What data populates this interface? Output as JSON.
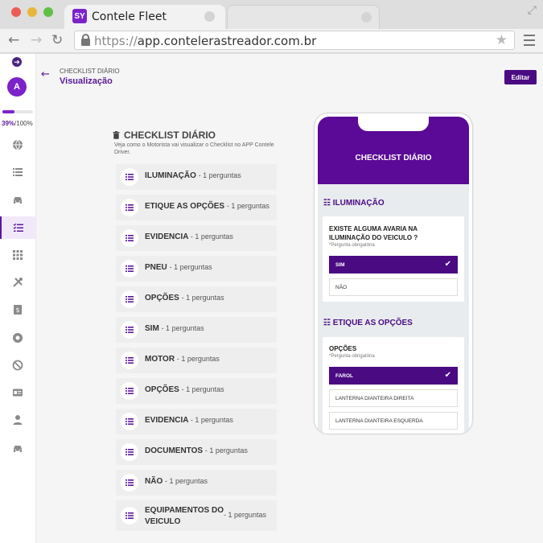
{
  "browser": {
    "tab_title": "Contele Fleet",
    "tab_logo": "SY",
    "url_protocol": "https://",
    "url_host": "app.contelerastreador.com.br"
  },
  "sidebar": {
    "avatar_initial": "A",
    "progress_percent": 39,
    "progress_value": "39%",
    "progress_total": "/100%",
    "icons": [
      "globe-icon",
      "list-icon",
      "car-icon",
      "checklist-icon",
      "grid-icon",
      "tools-icon",
      "document-dollar-icon",
      "record-icon",
      "block-icon",
      "id-card-icon",
      "user-icon",
      "car-icon"
    ]
  },
  "header": {
    "breadcrumb": "CHECKLIST DIÁRIO",
    "title": "Visualização",
    "edit_label": "Editar"
  },
  "checklist": {
    "title": "CHECKLIST DIÁRIO",
    "description": "Veja como o Motorista vai visualizar o Checklist no APP Contele Driver.",
    "categories": [
      {
        "name": "ILUMINAÇÃO",
        "count": "- 1 perguntas"
      },
      {
        "name": "ETIQUE AS OPÇÕES",
        "count": "- 1 perguntas"
      },
      {
        "name": "EVIDENCIA",
        "count": "- 1 perguntas"
      },
      {
        "name": "PNEU",
        "count": "- 1 perguntas"
      },
      {
        "name": "OPÇÕES",
        "count": "- 1 perguntas"
      },
      {
        "name": "SIM",
        "count": "- 1 perguntas"
      },
      {
        "name": "MOTOR",
        "count": "- 1 perguntas"
      },
      {
        "name": "OPÇÕES",
        "count": "- 1 perguntas"
      },
      {
        "name": "EVIDENCIA",
        "count": "- 1 perguntas"
      },
      {
        "name": "DOCUMENTOS",
        "count": "- 1 perguntas"
      },
      {
        "name": "NÃO",
        "count": "- 1 perguntas"
      },
      {
        "name": "EQUIPAMENTOS DO VEICULO",
        "count": "- 1 perguntas"
      }
    ]
  },
  "phone": {
    "title": "CHECKLIST DIÁRIO",
    "sections": [
      {
        "title": "ILUMINAÇÃO",
        "question": "EXISTE ALGUMA AVARIA NA ILUMINAÇÃO DO VEICULO ?",
        "required": "*Pergunta obrigatória",
        "options": [
          {
            "label": "SIM",
            "selected": true
          },
          {
            "label": "NÃO",
            "selected": false
          }
        ]
      },
      {
        "title": "ETIQUE AS OPÇÕES",
        "question": "OPÇÕES",
        "required": "*Pergunta obrigatória",
        "options": [
          {
            "label": "FAROL",
            "selected": true
          },
          {
            "label": "LANTERNA DIANTEIRA DIREITA",
            "selected": false
          },
          {
            "label": "LANTERNA DIANTEIRA ESQUERDA",
            "selected": false
          }
        ]
      }
    ]
  },
  "colors": {
    "accent": "#5a189a",
    "accent_dark": "#4a0a82",
    "phone_header": "#5a0a96"
  }
}
